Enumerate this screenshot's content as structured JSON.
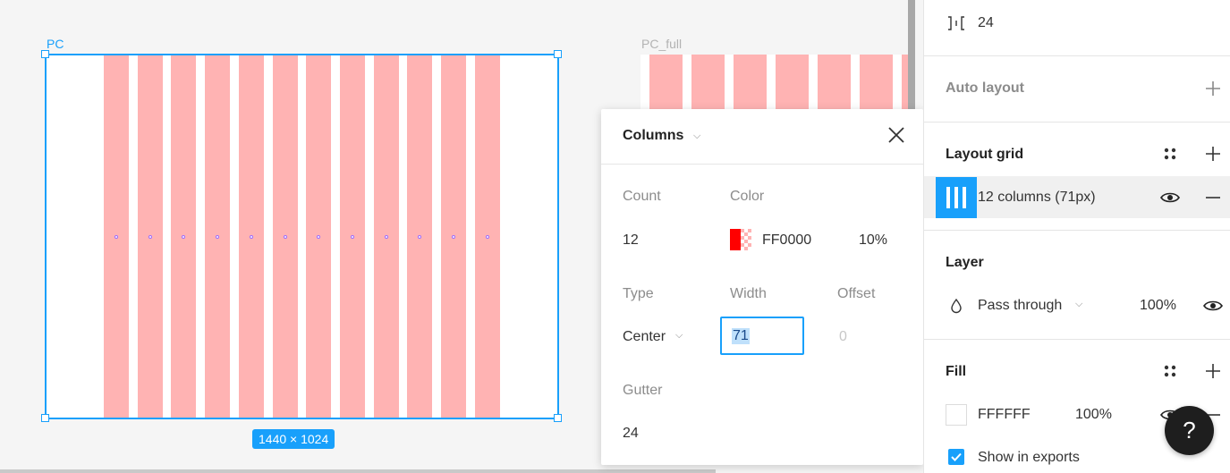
{
  "canvas": {
    "frames": [
      {
        "name": "PC",
        "size_label": "1440 × 1024"
      },
      {
        "name": "PC_full"
      }
    ]
  },
  "grid_popup": {
    "title": "Columns",
    "count_label": "Count",
    "count_value": "12",
    "color_label": "Color",
    "color_hex": "FF0000",
    "color_opacity": "10%",
    "type_label": "Type",
    "type_value": "Center",
    "width_label": "Width",
    "width_value": "71",
    "offset_label": "Offset",
    "offset_value": "0",
    "gutter_label": "Gutter",
    "gutter_value": "24"
  },
  "panel": {
    "spacing_value": "24",
    "auto_layout_title": "Auto layout",
    "layout_grid_title": "Layout grid",
    "layout_grid_item": "12 columns (71px)",
    "layer_title": "Layer",
    "blend_mode": "Pass through",
    "layer_opacity": "100%",
    "fill_title": "Fill",
    "fill_hex": "FFFFFF",
    "fill_opacity": "100%",
    "show_in_exports": "Show in exports"
  },
  "help": {
    "label": "?"
  },
  "colors": {
    "selection": "#18a0fb",
    "grid_column": "#ffb3b3",
    "swatch_red": "#ff0000",
    "panel_bg": "#ffffff",
    "canvas_bg": "#f5f5f5"
  }
}
